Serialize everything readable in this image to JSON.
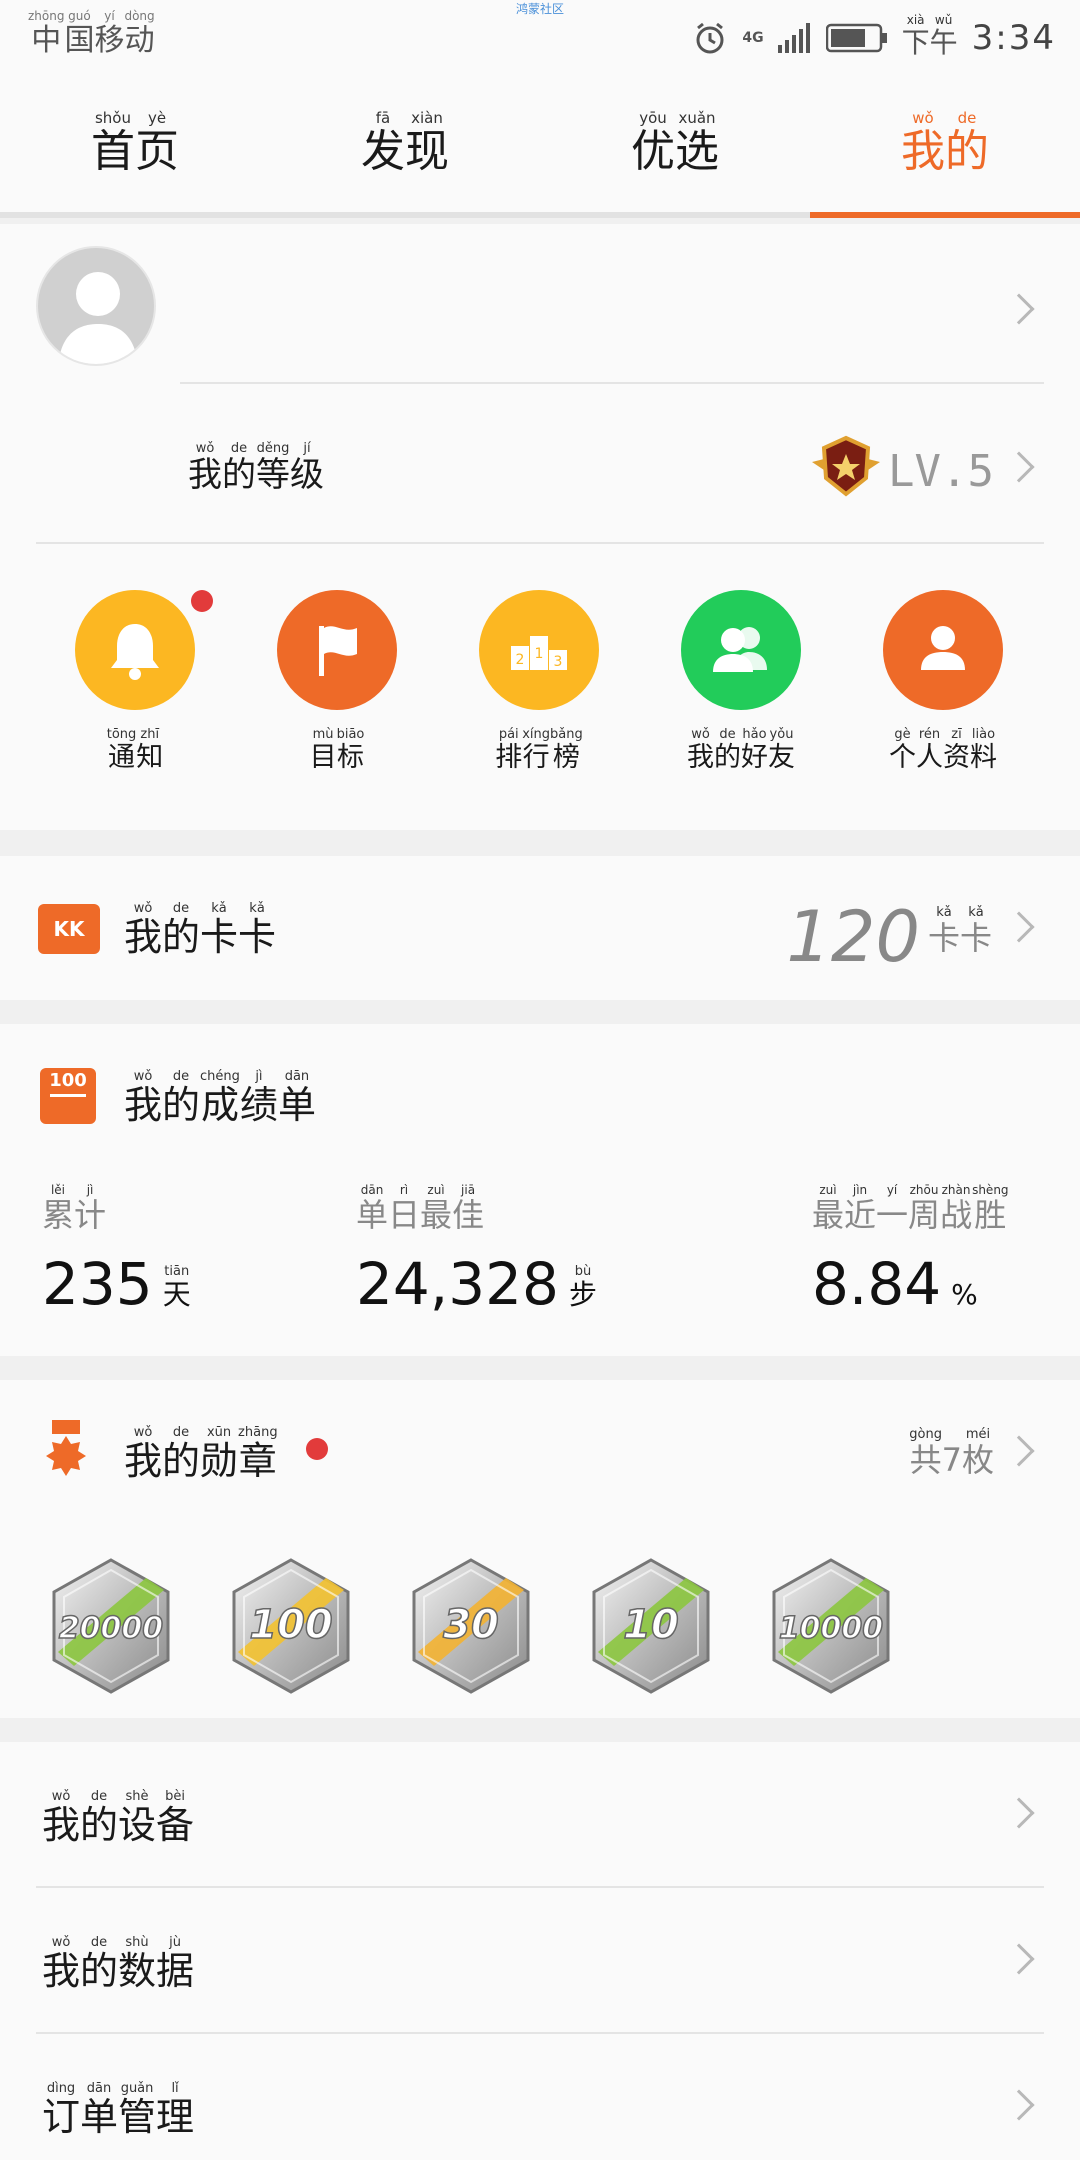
{
  "status_bar": {
    "carrier": [
      {
        "char": "中",
        "py": "zhōng"
      },
      {
        "char": "国",
        "py": "guó"
      },
      {
        "char": "移",
        "py": "yí"
      },
      {
        "char": "动",
        "py": "dòng"
      }
    ],
    "top_note": "鸿蒙社区",
    "network": "4G",
    "ampm": [
      {
        "char": "下",
        "py": "xià"
      },
      {
        "char": "午",
        "py": "wǔ"
      }
    ],
    "time": "3:34"
  },
  "tabs": [
    {
      "chars": [
        {
          "char": "首",
          "py": "shǒu"
        },
        {
          "char": "页",
          "py": "yè"
        }
      ]
    },
    {
      "chars": [
        {
          "char": "发",
          "py": "fā"
        },
        {
          "char": "现",
          "py": "xiàn"
        }
      ]
    },
    {
      "chars": [
        {
          "char": "优",
          "py": "yōu"
        },
        {
          "char": "选",
          "py": "xuǎn"
        }
      ]
    },
    {
      "chars": [
        {
          "char": "我",
          "py": "wǒ"
        },
        {
          "char": "的",
          "py": "de"
        }
      ],
      "active": true
    }
  ],
  "profile": {
    "level_label": [
      {
        "char": "我",
        "py": "wǒ"
      },
      {
        "char": "的",
        "py": "de"
      },
      {
        "char": "等",
        "py": "děng"
      },
      {
        "char": "级",
        "py": "jí"
      }
    ],
    "level_value": "LV.5"
  },
  "shortcuts": [
    {
      "label": [
        {
          "char": "通",
          "py": "tōng"
        },
        {
          "char": "知",
          "py": "zhī"
        }
      ],
      "color": "#fcb722",
      "icon": "bell-icon",
      "dot": true
    },
    {
      "label": [
        {
          "char": "目",
          "py": "mù"
        },
        {
          "char": "标",
          "py": "biāo"
        }
      ],
      "color": "#ee6a28",
      "icon": "flag-icon"
    },
    {
      "label": [
        {
          "char": "排",
          "py": "pái"
        },
        {
          "char": "行",
          "py": "xíng"
        },
        {
          "char": "榜",
          "py": "bǎng"
        }
      ],
      "color": "#fcb722",
      "icon": "podium-icon"
    },
    {
      "label": [
        {
          "char": "我",
          "py": "wǒ"
        },
        {
          "char": "的",
          "py": "de"
        },
        {
          "char": "好",
          "py": "hǎo"
        },
        {
          "char": "友",
          "py": "yǒu"
        }
      ],
      "color": "#22cc5a",
      "icon": "friends-icon"
    },
    {
      "label": [
        {
          "char": "个",
          "py": "gè"
        },
        {
          "char": "人",
          "py": "rén"
        },
        {
          "char": "资",
          "py": "zī"
        },
        {
          "char": "料",
          "py": "liào"
        }
      ],
      "color": "#ee6a28",
      "icon": "person-icon"
    }
  ],
  "kaka": {
    "badge": "KK",
    "title": [
      {
        "char": "我",
        "py": "wǒ"
      },
      {
        "char": "的",
        "py": "de"
      },
      {
        "char": "卡",
        "py": "kǎ"
      },
      {
        "char": "卡",
        "py": "kǎ"
      }
    ],
    "value": "120",
    "unit": [
      {
        "char": "卡",
        "py": "kǎ"
      },
      {
        "char": "卡",
        "py": "kǎ"
      }
    ]
  },
  "scores": {
    "icon_text": "100",
    "title": [
      {
        "char": "我",
        "py": "wǒ"
      },
      {
        "char": "的",
        "py": "de"
      },
      {
        "char": "成",
        "py": "chéng"
      },
      {
        "char": "绩",
        "py": "jì"
      },
      {
        "char": "单",
        "py": "dān"
      }
    ],
    "stats": [
      {
        "label": [
          {
            "char": "累",
            "py": "lěi"
          },
          {
            "char": "计",
            "py": "jì"
          }
        ],
        "value": "235",
        "unit": [
          {
            "char": "天",
            "py": "tiān"
          }
        ]
      },
      {
        "label": [
          {
            "char": "单",
            "py": "dān"
          },
          {
            "char": "日",
            "py": "rì"
          },
          {
            "char": "最",
            "py": "zuì"
          },
          {
            "char": "佳",
            "py": "jiā"
          }
        ],
        "value": "24,328",
        "unit": [
          {
            "char": "步",
            "py": "bù"
          }
        ]
      },
      {
        "label": [
          {
            "char": "最",
            "py": "zuì"
          },
          {
            "char": "近",
            "py": "jìn"
          },
          {
            "char": "一",
            "py": "yí"
          },
          {
            "char": "周",
            "py": "zhōu"
          },
          {
            "char": "战",
            "py": "zhàn"
          },
          {
            "char": "胜",
            "py": "shèng"
          }
        ],
        "value": "8.84",
        "unit": [
          {
            "char": "%",
            "py": ""
          }
        ]
      }
    ]
  },
  "medals": {
    "title": [
      {
        "char": "我",
        "py": "wǒ"
      },
      {
        "char": "的",
        "py": "de"
      },
      {
        "char": "勋",
        "py": "xūn"
      },
      {
        "char": "章",
        "py": "zhāng"
      }
    ],
    "count": [
      {
        "char": "共",
        "py": "gòng"
      },
      {
        "char": "7",
        "py": ""
      },
      {
        "char": "枚",
        "py": "méi"
      }
    ],
    "items": [
      {
        "text": "20000",
        "stripe": "#8cc63f"
      },
      {
        "text": "100",
        "stripe": "#f3c230"
      },
      {
        "text": "30",
        "stripe": "#f3b332"
      },
      {
        "text": "10",
        "stripe": "#8cc63f"
      },
      {
        "text": "10000",
        "stripe": "#8cc63f"
      }
    ]
  },
  "list": [
    {
      "label": [
        {
          "char": "我",
          "py": "wǒ"
        },
        {
          "char": "的",
          "py": "de"
        },
        {
          "char": "设",
          "py": "shè"
        },
        {
          "char": "备",
          "py": "bèi"
        }
      ]
    },
    {
      "label": [
        {
          "char": "我",
          "py": "wǒ"
        },
        {
          "char": "的",
          "py": "de"
        },
        {
          "char": "数",
          "py": "shù"
        },
        {
          "char": "据",
          "py": "jù"
        }
      ]
    },
    {
      "label": [
        {
          "char": "订",
          "py": "dìng"
        },
        {
          "char": "单",
          "py": "dān"
        },
        {
          "char": "管",
          "py": "guǎn"
        },
        {
          "char": "理",
          "py": "lǐ"
        }
      ]
    }
  ],
  "colors": {
    "accent": "#ee6a28",
    "dot": "#e23b3b"
  }
}
